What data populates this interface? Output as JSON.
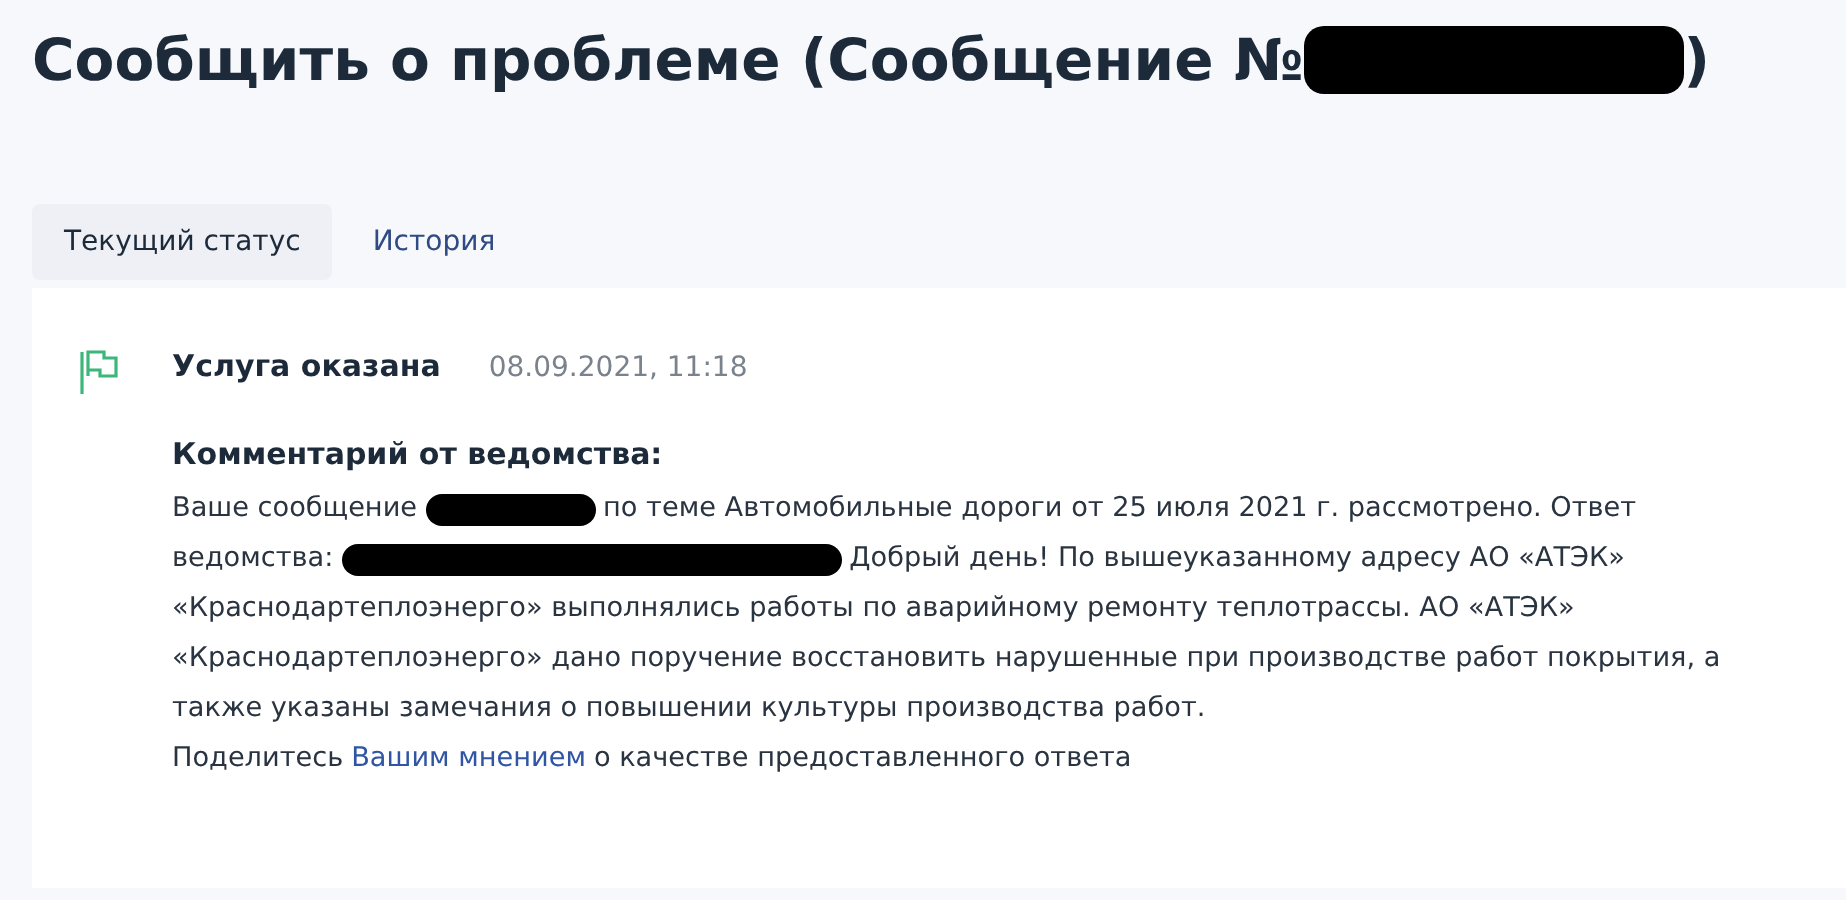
{
  "title": [
    {
      "kind": "text",
      "text": "Сообщить о проблеме (Сообщение №"
    },
    {
      "kind": "redaction"
    },
    {
      "kind": "text",
      "text": ")"
    }
  ],
  "tabs": [
    {
      "label": "Текущий статус",
      "selected": true
    },
    {
      "label": "История",
      "selected": false
    }
  ],
  "status": {
    "label": "Услуга оказана",
    "date": "08.09.2021, 11:18"
  },
  "comment": {
    "heading": "Комментарий от ведомства:",
    "lines": [
      [
        {
          "kind": "text",
          "text": "Ваше сообщение"
        },
        {
          "kind": "redaction"
        },
        {
          "kind": "text",
          "text": "по теме Автомобильные дороги от 25 июля 2021 г. рассмотрено. Ответ"
        }
      ],
      [
        {
          "kind": "text",
          "text": "ведомства:"
        },
        {
          "kind": "redaction"
        },
        {
          "kind": "text",
          "text": "Добрый день! По вышеуказанному адресу АО «АТЭК»"
        }
      ],
      [
        {
          "kind": "text",
          "text": "«Краснодартеплоэнерго» выполнялись работы по аварийному ремонту теплотрассы. АО «АТЭК»"
        }
      ],
      [
        {
          "kind": "text",
          "text": "«Краснодартеплоэнерго» дано поручение восстановить нарушенные при производстве работ покрытия, а"
        }
      ],
      [
        {
          "kind": "text",
          "text": "также указаны замечания о повышении культуры производства работ."
        }
      ],
      [
        {
          "kind": "text",
          "text": "Поделитесь"
        },
        {
          "kind": "link",
          "text": "Вашим мнением"
        },
        {
          "kind": "text",
          "text": "о качестве предоставленного ответа"
        }
      ]
    ]
  }
}
